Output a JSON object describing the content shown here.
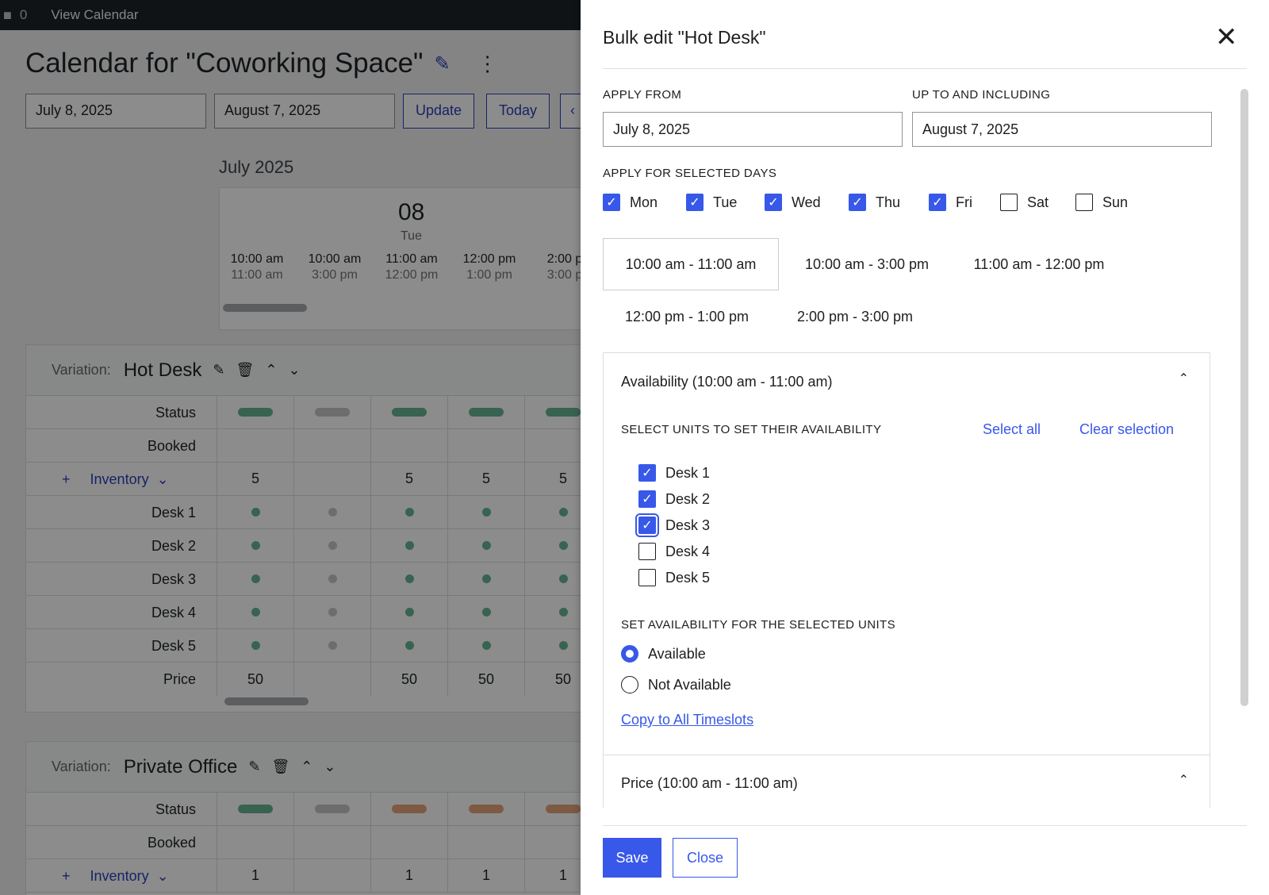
{
  "adminbar": {
    "comments": "0",
    "view_calendar": "View Calendar"
  },
  "page": {
    "title": "Calendar for \"Coworking Space\"",
    "from_date": "July 8, 2025",
    "to_date": "August 7, 2025",
    "update_label": "Update",
    "today_label": "Today",
    "month": "July 2025",
    "day_number": "08",
    "day_name": "Tue",
    "slots": [
      {
        "start": "10:00 am",
        "end": "11:00 am"
      },
      {
        "start": "10:00 am",
        "end": "3:00 pm"
      },
      {
        "start": "11:00 am",
        "end": "12:00 pm"
      },
      {
        "start": "12:00 pm",
        "end": "1:00 pm"
      },
      {
        "start": "2:00 p",
        "end": "3:00 p"
      }
    ]
  },
  "variations": [
    {
      "label": "Variation:",
      "name": "Hot Desk",
      "rows": {
        "status": "Status",
        "booked": "Booked",
        "inventory": "Inventory",
        "inventory_values": [
          "5",
          "",
          "5",
          "5",
          "5"
        ],
        "desks": [
          "Desk 1",
          "Desk 2",
          "Desk 3",
          "Desk 4",
          "Desk 5"
        ],
        "price": "Price",
        "price_values": [
          "50",
          "",
          "50",
          "50",
          "50"
        ]
      },
      "status_colors": [
        "#66b594",
        "#c7c7c7",
        "#66b594",
        "#66b594",
        "#66b594"
      ]
    },
    {
      "label": "Variation:",
      "name": "Private Office",
      "rows": {
        "status": "Status",
        "booked": "Booked",
        "inventory": "Inventory",
        "inventory_values": [
          "1",
          "",
          "1",
          "1",
          "1"
        ]
      },
      "status_colors": [
        "#66b594",
        "#c7c7c7",
        "#e6a579",
        "#e6a579",
        "#e6a579"
      ]
    }
  ],
  "panel": {
    "title": "Bulk edit \"Hot Desk\"",
    "apply_from_label": "APPLY FROM",
    "apply_from_value": "July 8, 2025",
    "up_to_label": "UP TO AND INCLUDING",
    "up_to_value": "August 7, 2025",
    "days_label": "APPLY FOR SELECTED DAYS",
    "days": [
      {
        "label": "Mon",
        "checked": true
      },
      {
        "label": "Tue",
        "checked": true
      },
      {
        "label": "Wed",
        "checked": true
      },
      {
        "label": "Thu",
        "checked": true
      },
      {
        "label": "Fri",
        "checked": true
      },
      {
        "label": "Sat",
        "checked": false
      },
      {
        "label": "Sun",
        "checked": false
      }
    ],
    "timeslots": [
      "10:00 am - 11:00 am",
      "10:00 am - 3:00 pm",
      "11:00 am - 12:00 pm",
      "12:00 pm - 1:00 pm",
      "2:00 pm - 3:00 pm"
    ],
    "selected_timeslot": "10:00 am - 11:00 am",
    "availability": {
      "heading": "Availability (10:00 am - 11:00 am)",
      "units_label": "SELECT UNITS TO SET THEIR AVAILABILITY",
      "select_all": "Select all",
      "clear_selection": "Clear selection",
      "units": [
        {
          "label": "Desk 1",
          "checked": true
        },
        {
          "label": "Desk 2",
          "checked": true
        },
        {
          "label": "Desk 3",
          "checked": true
        },
        {
          "label": "Desk 4",
          "checked": false
        },
        {
          "label": "Desk 5",
          "checked": false
        }
      ],
      "set_label": "SET AVAILABILITY FOR THE SELECTED UNITS",
      "available": "Available",
      "not_available": "Not Available",
      "selected_option": "Available",
      "copy_link": "Copy to All Timeslots"
    },
    "price_heading": "Price (10:00 am - 11:00 am)",
    "save_label": "Save",
    "close_label": "Close"
  },
  "colors": {
    "accent": "#3858e9",
    "status_green": "#66b594",
    "status_grey": "#c7c7c7",
    "status_orange": "#e6a579"
  }
}
